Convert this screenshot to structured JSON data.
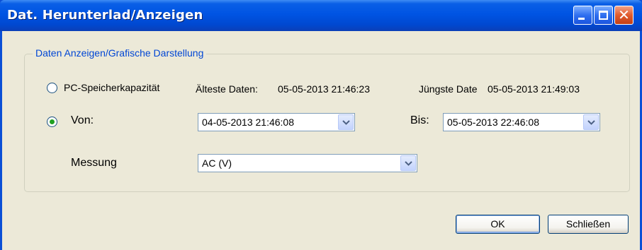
{
  "window": {
    "title": "Dat. Herunterlad/Anzeigen"
  },
  "group": {
    "title": "Daten Anzeigen/Grafische Darstellung"
  },
  "pc_storage": {
    "label": "PC-Speicherkapazität",
    "selected": false,
    "oldest_label": "Älteste Daten:",
    "oldest_value": "05-05-2013 21:46:23",
    "newest_label": "Jüngste Date",
    "newest_value": "05-05-2013 21:49:03"
  },
  "range": {
    "label": "Von:",
    "selected": true,
    "from_value": "04-05-2013 21:46:08",
    "to_label": "Bis:",
    "to_value": "05-05-2013 22:46:08"
  },
  "measurement": {
    "label": "Messung",
    "value": "AC (V)"
  },
  "buttons": {
    "ok": "OK",
    "close": "Schließen"
  },
  "colors": {
    "title_bar": "#0054e3",
    "dialog_bg": "#ece9d8",
    "group_title": "#0046d5",
    "radio_dot": "#21a121"
  }
}
